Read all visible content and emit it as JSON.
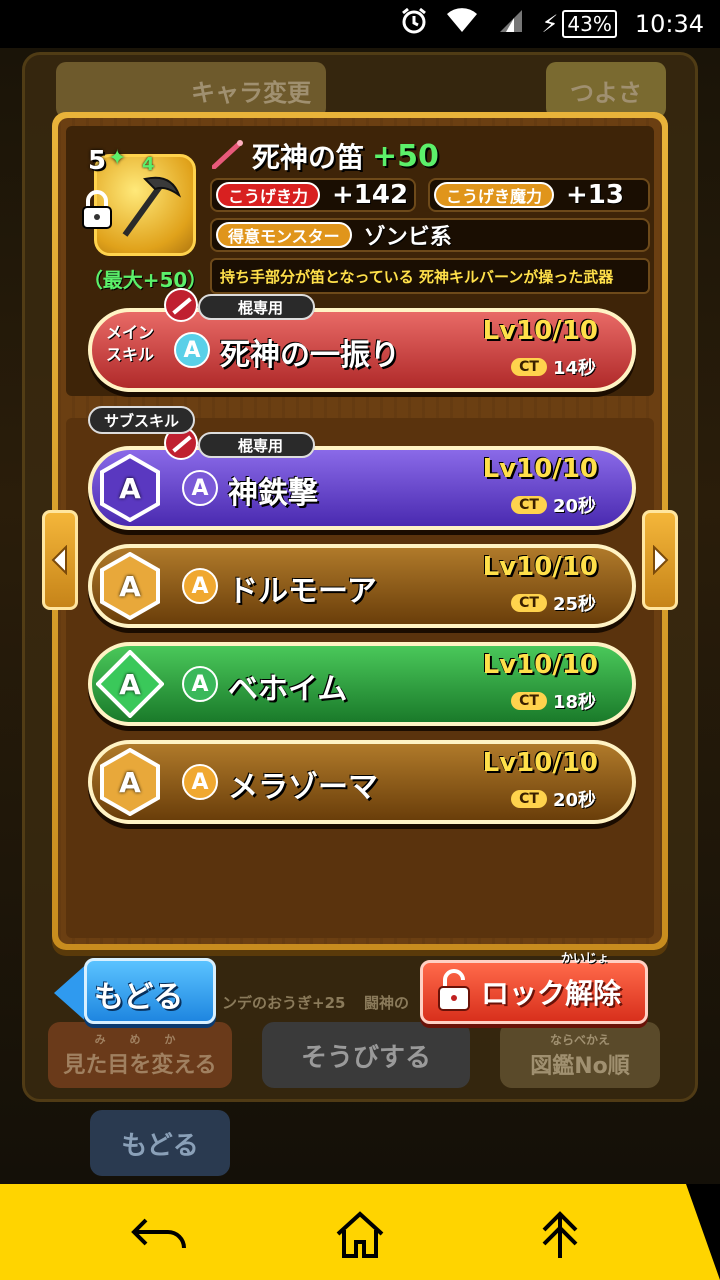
{
  "status_bar": {
    "battery": "43%",
    "time": "10:34"
  },
  "background": {
    "tab_change_character": "キャラ変更",
    "tab_strength": "つよさ",
    "change_look_ruby": "み め か",
    "change_look_button": "見た目を変える",
    "equip_button": "そうびする",
    "sort_ruby": "ならべかえ",
    "sort_button": "図鑑No順",
    "back_button": "もどる",
    "item_label_1": "ンデのおうぎ+25",
    "item_label_2": "闘神の"
  },
  "weapon": {
    "level": "5",
    "sub_level": "4",
    "max_label": "（最大+50）",
    "name": "死神の笛",
    "plus": "+50",
    "attack_label": "こうげき力",
    "attack_value": "+142",
    "magic_label": "こうげき魔力",
    "magic_value": "+13",
    "favorite_label": "得意モンスター",
    "favorite_value": "ゾンビ系",
    "description": "持ち手部分が笛となっている 死神キルバーンが操った武器"
  },
  "main_skill": {
    "section_label": "メイン\nスキル",
    "tag": "棍専用",
    "rank": "A",
    "name": "死神の一振り",
    "level": "Lv10/10",
    "ct_label": "CT",
    "ct_value": "14秒"
  },
  "sub_skill_title": "サブスキル",
  "sub_skills": [
    {
      "tag": "棍専用",
      "rank": "A",
      "name": "神鉄撃",
      "level": "Lv10/10",
      "ct_label": "CT",
      "ct_value": "20秒",
      "color": "#6a43c8"
    },
    {
      "rank": "A",
      "name": "ドルモーア",
      "level": "Lv10/10",
      "ct_label": "CT",
      "ct_value": "25秒",
      "color": "#8a5418"
    },
    {
      "rank": "A",
      "name": "ベホイム",
      "level": "Lv10/10",
      "ct_label": "CT",
      "ct_value": "18秒",
      "color": "#2a9a3a"
    },
    {
      "rank": "A",
      "name": "メラゾーマ",
      "level": "Lv10/10",
      "ct_label": "CT",
      "ct_value": "20秒",
      "color": "#8a5418"
    }
  ],
  "buttons": {
    "back": "もどる",
    "unlock_ruby": "かいじょ",
    "unlock": "ロック解除"
  },
  "colors": {
    "main_skill": "#c8403e",
    "accent_green": "#5cf06a",
    "level_yellow": "#ffe04a",
    "nav_yellow": "#ffd400"
  }
}
